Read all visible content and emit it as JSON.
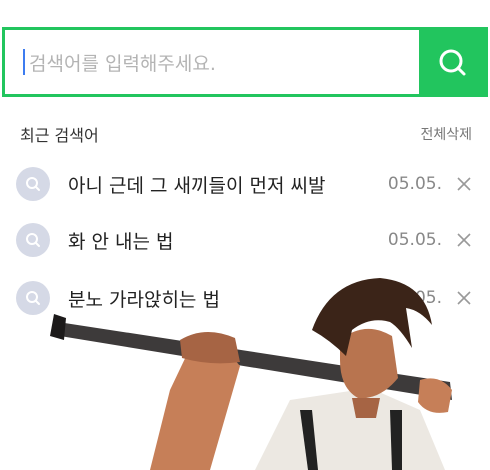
{
  "search": {
    "placeholder": "검색어를 입력해주세요."
  },
  "recent": {
    "title": "최근 검색어",
    "delete_all": "전체삭제",
    "items": [
      {
        "text": "아니 근데 그 새끼들이 먼저 씨발",
        "date": "05.05."
      },
      {
        "text": "화 안 내는 법",
        "date": "05.05."
      },
      {
        "text": "분노 가라앉히는 법",
        "date": "05.05."
      }
    ]
  },
  "colors": {
    "accent": "#22c55e",
    "icon_bg": "#d5d9e6",
    "caret": "#3d7cf0"
  },
  "icons": [
    "search-icon",
    "close-icon"
  ]
}
